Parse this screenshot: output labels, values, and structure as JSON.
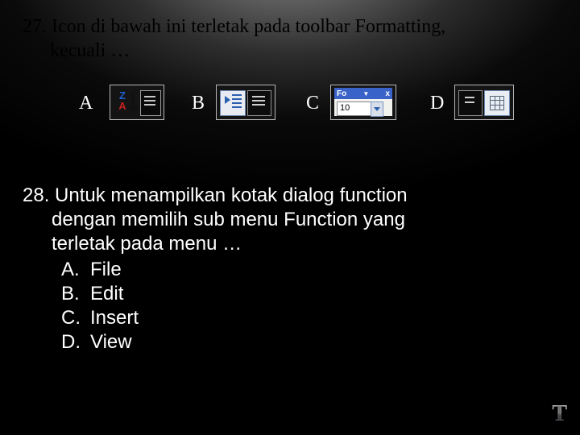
{
  "q27": {
    "number": "27.",
    "line1": "Icon di  bawah ini terletak pada toolbar Formatting,",
    "line2": "kecuali …",
    "options": {
      "A": {
        "label": "A",
        "icon": "sort-za-icon",
        "za_Z": "Z",
        "za_A": "A"
      },
      "B": {
        "label": "B",
        "icon": "increase-indent-icon"
      },
      "C": {
        "label": "C",
        "icon": "font-size-toolbar-icon",
        "titlebar_text": "Fo",
        "titlebar_tri": "▼",
        "titlebar_close": "x",
        "field_value": "10"
      },
      "D": {
        "label": "D",
        "icon": "borders-grid-icon"
      }
    }
  },
  "q28": {
    "number": "28.",
    "stem_l1": "Untuk menampilkan kotak dialog function",
    "stem_l2": "dengan memilih sub menu Function yang",
    "stem_l3": "terletak pada menu …",
    "choices": [
      {
        "label": "A.",
        "text": "File"
      },
      {
        "label": "B.",
        "text": "Edit"
      },
      {
        "label": "C.",
        "text": "Insert"
      },
      {
        "label": "D.",
        "text": "View"
      }
    ]
  },
  "footer": {
    "T": "T"
  }
}
